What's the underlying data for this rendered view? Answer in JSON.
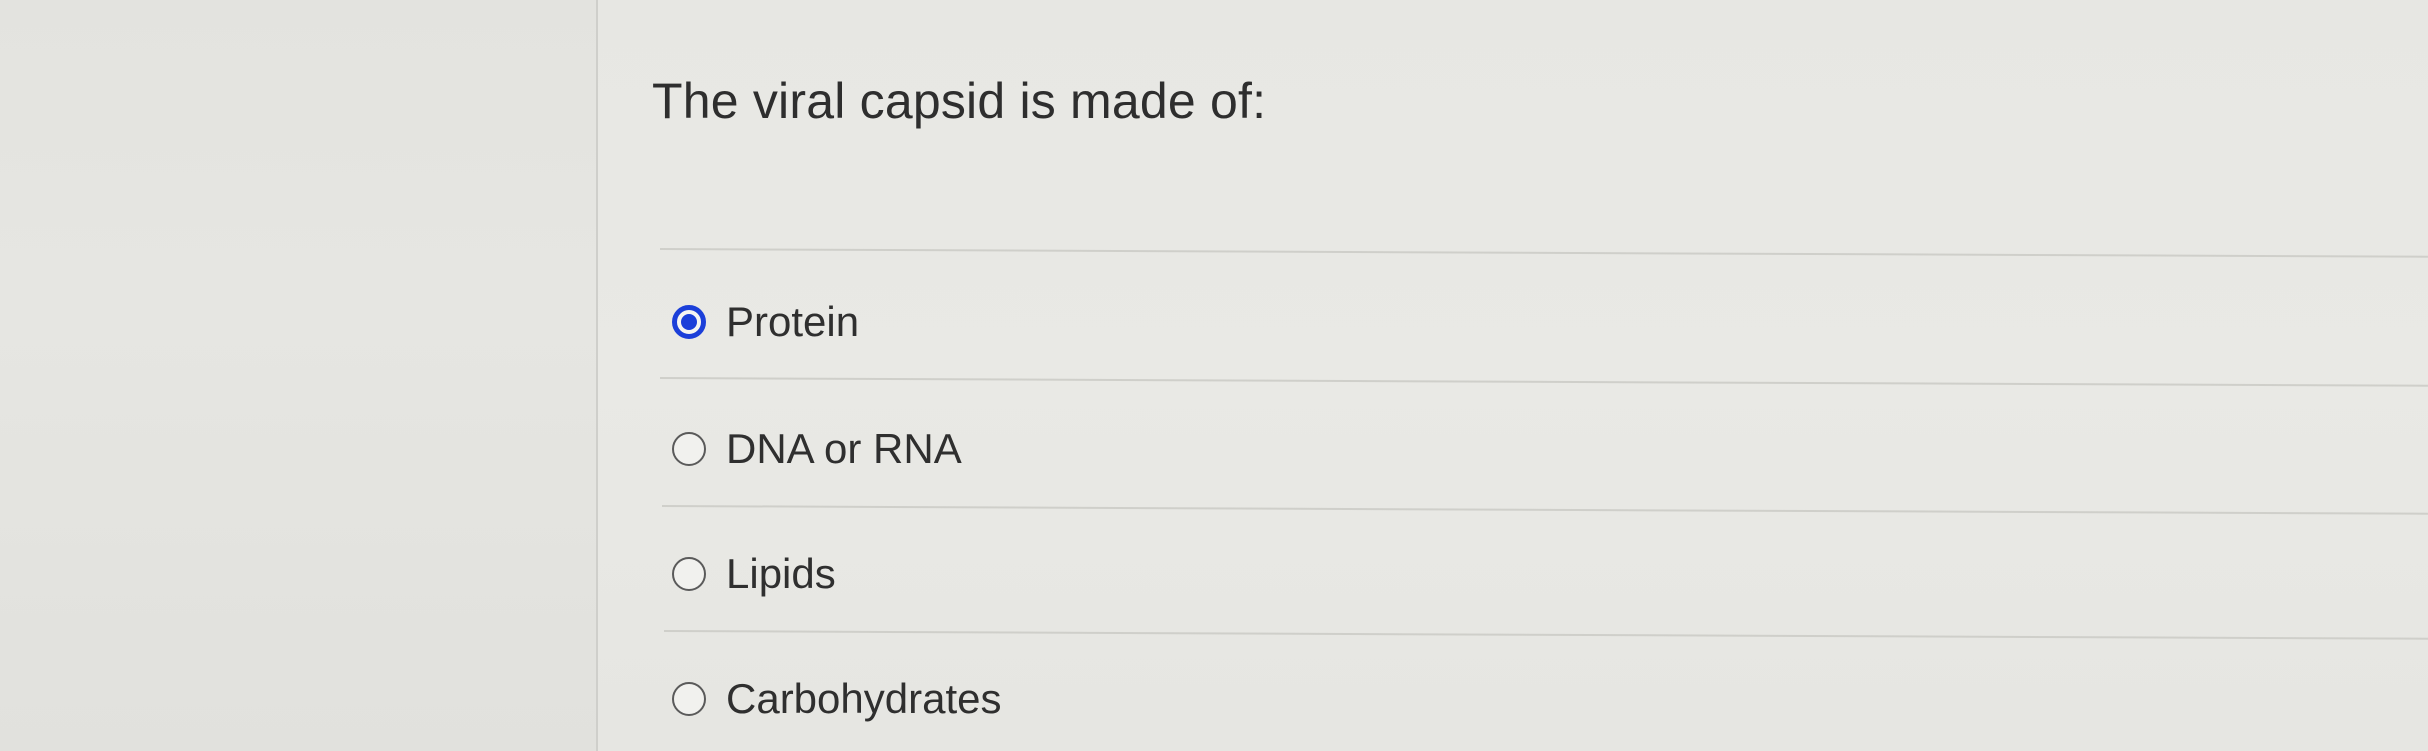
{
  "question": {
    "text": "The viral capsid is made of:"
  },
  "options": [
    {
      "label": "Protein",
      "selected": true
    },
    {
      "label": "DNA or RNA",
      "selected": false
    },
    {
      "label": "Lipids",
      "selected": false
    },
    {
      "label": "Carbohydrates",
      "selected": false
    }
  ],
  "colors": {
    "accent": "#1b3fd9",
    "text": "#2f2f2f",
    "background": "#e8e8e4"
  }
}
